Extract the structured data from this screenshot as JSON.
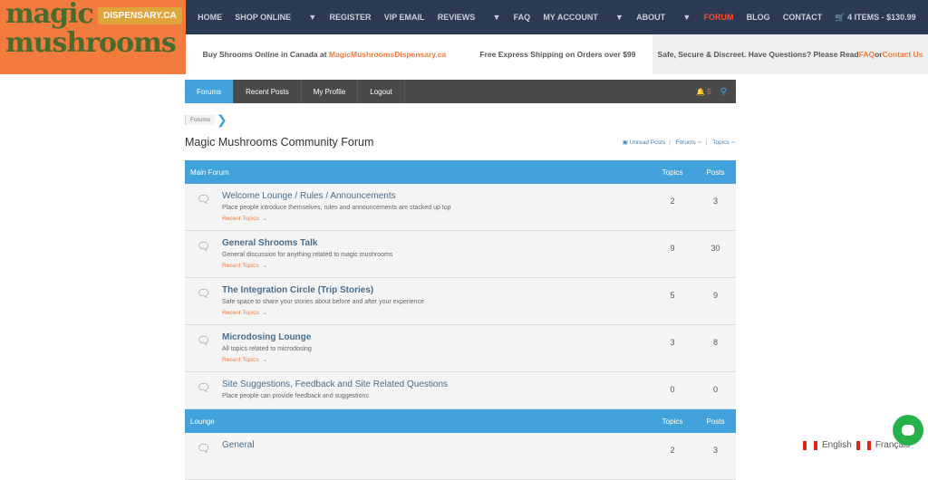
{
  "logo": {
    "line1": "magic",
    "line2": "mushrooms",
    "badge": "DISPENSARY.CA"
  },
  "nav": [
    "HOME",
    "SHOP ONLINE",
    "REGISTER",
    "VIP EMAIL",
    "REVIEWS",
    "FAQ",
    "MY ACCOUNT",
    "ABOUT",
    "FORUM",
    "BLOG",
    "CONTACT"
  ],
  "cart": "4 ITEMS - $130.99",
  "sub": {
    "buy": "Buy Shrooms Online in Canada at ",
    "site": "MagicMushroomsDispensary.ca",
    "ship": "Free Express Shipping on Orders over $99",
    "safe": "Safe, Secure & Discreet. Have Questions? Please Read ",
    "faq": "FAQ",
    "or": " or ",
    "contact": "Contact Us"
  },
  "toolbar": {
    "tabs": [
      "Forums",
      "Recent Posts",
      "My Profile",
      "Logout"
    ],
    "notif_count": "5"
  },
  "breadcrumb": "Forums",
  "title": "Magic Mushrooms Community Forum",
  "links": {
    "unread": "Unread Posts",
    "forums": "Forums",
    "topics": "Topics"
  },
  "sections": [
    {
      "name": "Main Forum",
      "topics_label": "Topics",
      "posts_label": "Posts",
      "rows": [
        {
          "name": "Welcome Lounge / Rules / Announcements",
          "desc": "Place people introduce themselves, rules and announcements are stacked up top",
          "recent": "Recent Topics",
          "topics": "2",
          "posts": "3",
          "bold": false
        },
        {
          "name": "General Shrooms Talk",
          "desc": "General discussion for anything related to magic mushrooms",
          "recent": "Recent Topics",
          "topics": "9",
          "posts": "30",
          "bold": true
        },
        {
          "name": "The Integration Circle (Trip Stories)",
          "desc": "Safe space to share your stories about before and after your experience",
          "recent": "Recent Topics",
          "topics": "5",
          "posts": "9",
          "bold": true
        },
        {
          "name": "Microdosing Lounge",
          "desc": "All topics related to microdosing",
          "recent": "Recent Topics",
          "topics": "3",
          "posts": "8",
          "bold": true
        },
        {
          "name": "Site Suggestions, Feedback and Site Related Questions",
          "desc": "Place people can provide feedback and suggestions",
          "recent": "",
          "topics": "0",
          "posts": "0",
          "bold": false
        }
      ]
    },
    {
      "name": "Lounge",
      "topics_label": "Topics",
      "posts_label": "Posts",
      "rows": [
        {
          "name": "General",
          "desc": "",
          "recent": "",
          "topics": "2",
          "posts": "3",
          "bold": false
        }
      ]
    }
  ],
  "lang": {
    "en": "English",
    "fr": "Français"
  }
}
